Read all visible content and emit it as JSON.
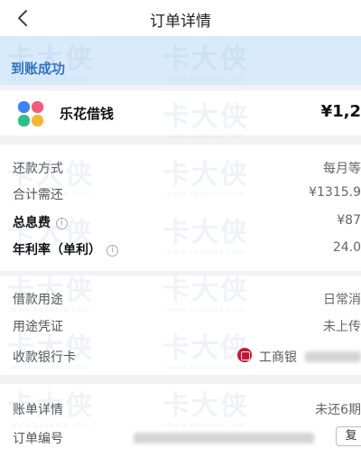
{
  "header": {
    "title": "订单详情"
  },
  "status": {
    "text": "到账成功"
  },
  "product": {
    "name": "乐花借钱",
    "amount": "¥1,2"
  },
  "repayment": {
    "method_label": "还款方式",
    "method_value": "每月等",
    "total_label": "合计需还",
    "total_value": "¥1315.9",
    "interest_label": "总息费",
    "interest_value": "¥87",
    "rate_label": "年利率（单利）",
    "rate_value": "24.0"
  },
  "loan": {
    "purpose_label": "借款用途",
    "purpose_value": "日常消",
    "voucher_label": "用途凭证",
    "voucher_value": "未上传",
    "card_label": "收款银行卡",
    "card_value": "工商银"
  },
  "bill": {
    "detail_label": "账单详情",
    "detail_value": "未还6期",
    "order_label": "订单编号",
    "copy_label": "复"
  },
  "watermark": {
    "brand": "卡大侠",
    "site": "www.kadaxia.com"
  },
  "colors": {
    "status_bg": "#d9ebfb",
    "status_text": "#2f73c9",
    "bank_red": "#c8102e"
  }
}
